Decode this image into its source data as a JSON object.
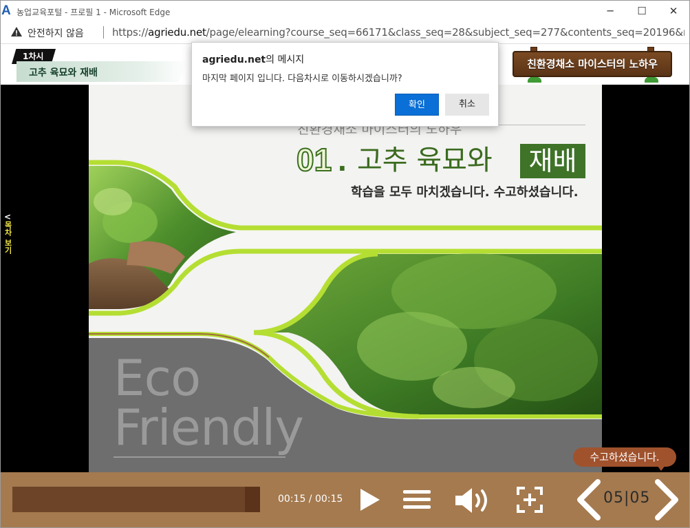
{
  "window": {
    "title": "농업교육포털 - 프로필 1 - Microsoft Edge",
    "app_icon_letter": "A",
    "minimize": "─",
    "maximize": "☐",
    "close": "✕"
  },
  "address": {
    "security_label": "안전하지 않음",
    "url_prefix": "https://",
    "url_host": "agriedu.net",
    "url_path": "/page/elearning?course_seq=66171&class_seq=28&subject_seq=277&contents_seq=20196&m..."
  },
  "lesson": {
    "session": "1차시",
    "title": "고추 육묘와 재배",
    "brand": "친환경채소 마이스터의 노하우"
  },
  "sidebar": {
    "toc_chevron": "<",
    "toc_label": "목차 보기"
  },
  "slide": {
    "subtitle": "친환경채소 마이스터의 노하우",
    "number": "01",
    "dot": ".",
    "title": "고추 육묘와",
    "title_highlight": "재배",
    "message": "학습을 모두 마치겠습니다. 수고하셨습니다.",
    "eco_line1": "Eco",
    "eco_line2": "Friendly"
  },
  "tooltip": "수고하셨습니다.",
  "player": {
    "progress_fraction": 0.94,
    "time": "00:15 / 00:15",
    "page": "05|05",
    "colors": {
      "bar": "#a57a4f",
      "track": "#6d4427",
      "fill": "#5a331a"
    }
  },
  "dialog": {
    "title_host": "agriedu.net",
    "title_suffix": "의 메시지",
    "message": "마지막 페이지 입니다. 다음차시로 이동하시겠습니까?",
    "ok_label": "확인",
    "cancel_label": "취소",
    "accent": "#0a6fd6"
  }
}
